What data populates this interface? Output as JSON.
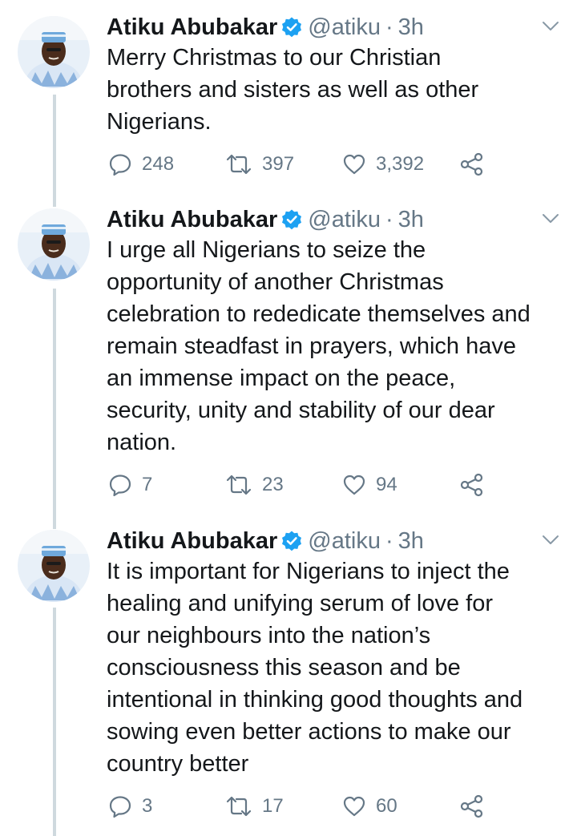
{
  "tweets": [
    {
      "name": "Atiku Abubakar",
      "handle": "@atiku",
      "separator": "·",
      "time": "3h",
      "lines": [
        "Merry Christmas to our Christian",
        "brothers and sisters as well as other",
        "Nigerians."
      ],
      "replies": "248",
      "retweets": "397",
      "likes": "3,392"
    },
    {
      "name": "Atiku Abubakar",
      "handle": "@atiku",
      "separator": "·",
      "time": "3h",
      "lines": [
        "I urge all Nigerians to seize the",
        "opportunity of another Christmas",
        "celebration to rededicate themselves and",
        "remain steadfast in prayers, which have",
        "an immense impact on the peace,",
        "security, unity and stability of our dear",
        "nation."
      ],
      "replies": "7",
      "retweets": "23",
      "likes": "94"
    },
    {
      "name": "Atiku Abubakar",
      "handle": "@atiku",
      "separator": "·",
      "time": "3h",
      "lines": [
        "It is important for Nigerians to inject the",
        "healing and unifying serum of love for",
        "our neighbours into the nation’s",
        "consciousness this season and be",
        "intentional in thinking good thoughts and",
        "sowing even better actions to make our",
        "country better"
      ],
      "replies": "3",
      "retweets": "17",
      "likes": "60"
    }
  ],
  "icons": {
    "verified": "verified-badge-icon",
    "caret": "chevron-down-icon",
    "reply": "reply-icon",
    "retweet": "retweet-icon",
    "like": "heart-icon",
    "share": "share-icon"
  },
  "colors": {
    "text": "#14171a",
    "secondary": "#657786",
    "verified": "#1da1f2",
    "thread_line": "#cfd9de"
  }
}
